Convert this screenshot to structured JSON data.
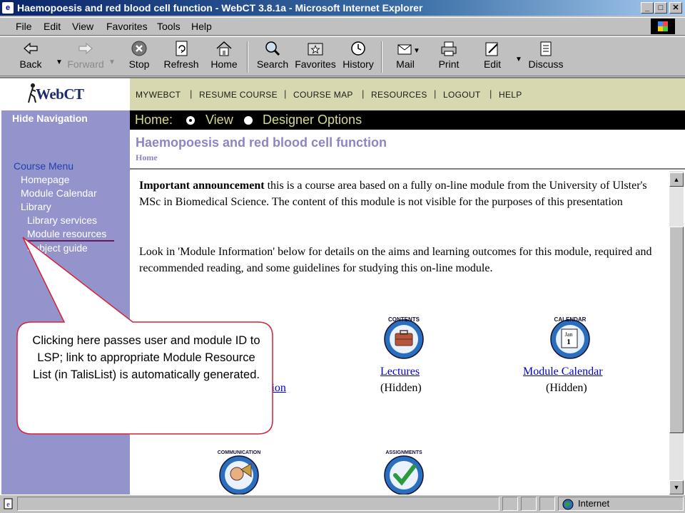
{
  "window": {
    "title": "Haemopoesis and red blood cell function - WebCT 3.8.1a - Microsoft Internet Explorer",
    "minimize": "_",
    "maximize": "□",
    "close": "✕"
  },
  "menubar": {
    "items": [
      "File",
      "Edit",
      "View",
      "Favorites",
      "Tools",
      "Help"
    ]
  },
  "toolbar": {
    "buttons": [
      {
        "label": "Back",
        "icon": "back-arrow-icon"
      },
      {
        "label": "Forward",
        "icon": "forward-arrow-icon",
        "disabled": true
      },
      {
        "label": "Stop",
        "icon": "stop-icon"
      },
      {
        "label": "Refresh",
        "icon": "refresh-icon"
      },
      {
        "label": "Home",
        "icon": "home-icon"
      },
      {
        "label": "Search",
        "icon": "search-icon"
      },
      {
        "label": "Favorites",
        "icon": "favorites-icon"
      },
      {
        "label": "History",
        "icon": "history-icon"
      },
      {
        "label": "Mail",
        "icon": "mail-icon"
      },
      {
        "label": "Print",
        "icon": "print-icon"
      },
      {
        "label": "Edit",
        "icon": "edit-icon"
      },
      {
        "label": "Discuss",
        "icon": "discuss-icon"
      }
    ]
  },
  "webct": {
    "logo": "WebCT",
    "topnav": [
      "MYWEBCT",
      "RESUME COURSE",
      "COURSE MAP",
      "RESOURCES",
      "LOGOUT",
      "HELP"
    ],
    "separator": "|",
    "homebar": {
      "label": "Home:",
      "view": "View",
      "designer": "Designer Options"
    }
  },
  "sidebar": {
    "hide_navigation": "Hide Navigation",
    "course_menu": "Course Menu",
    "items": [
      "Homepage",
      "Module Calendar",
      "Library"
    ],
    "library_items": [
      "Library services",
      "Module resources",
      "Subject guide"
    ]
  },
  "content": {
    "heading": "Haemopoesis and red blood cell function",
    "breadcrumb": "Home",
    "para1_bold": "Important announcement",
    "para1_rest": " this is a course area based on a fully on-line module from the University of Ulster's MSc in Biomedical Science. The content of this module is not visible for the purposes of this presentation",
    "para2": "Look in 'Module Information' below for details on the aims and learning outcomes for this module, required and recommended reading, and some guidelines for studying this on-line module.",
    "tools": [
      {
        "icon_label": "CONTENTS",
        "link": "Lectures",
        "status": "(Hidden)"
      },
      {
        "icon_label": "CALENDAR",
        "link": "Module Calendar",
        "status": "(Hidden)"
      }
    ],
    "partial_link": "tion",
    "calendar_icon_text": "Jan\n1",
    "bottom_icons": [
      "COMMUNICATION",
      "ASSIGNMENTS"
    ]
  },
  "callout": {
    "text": "Clicking here passes user and module ID to LSP; link to appropriate Module Resource List (in TalisList) is automatically generated."
  },
  "statusbar": {
    "zone": "Internet"
  },
  "colors": {
    "sidebar_bg": "#9494cc",
    "topnav_bg": "#d8d8b0",
    "homebar_text": "#d8d890",
    "heading": "#8e84c4",
    "callout_border": "#d8203a"
  }
}
